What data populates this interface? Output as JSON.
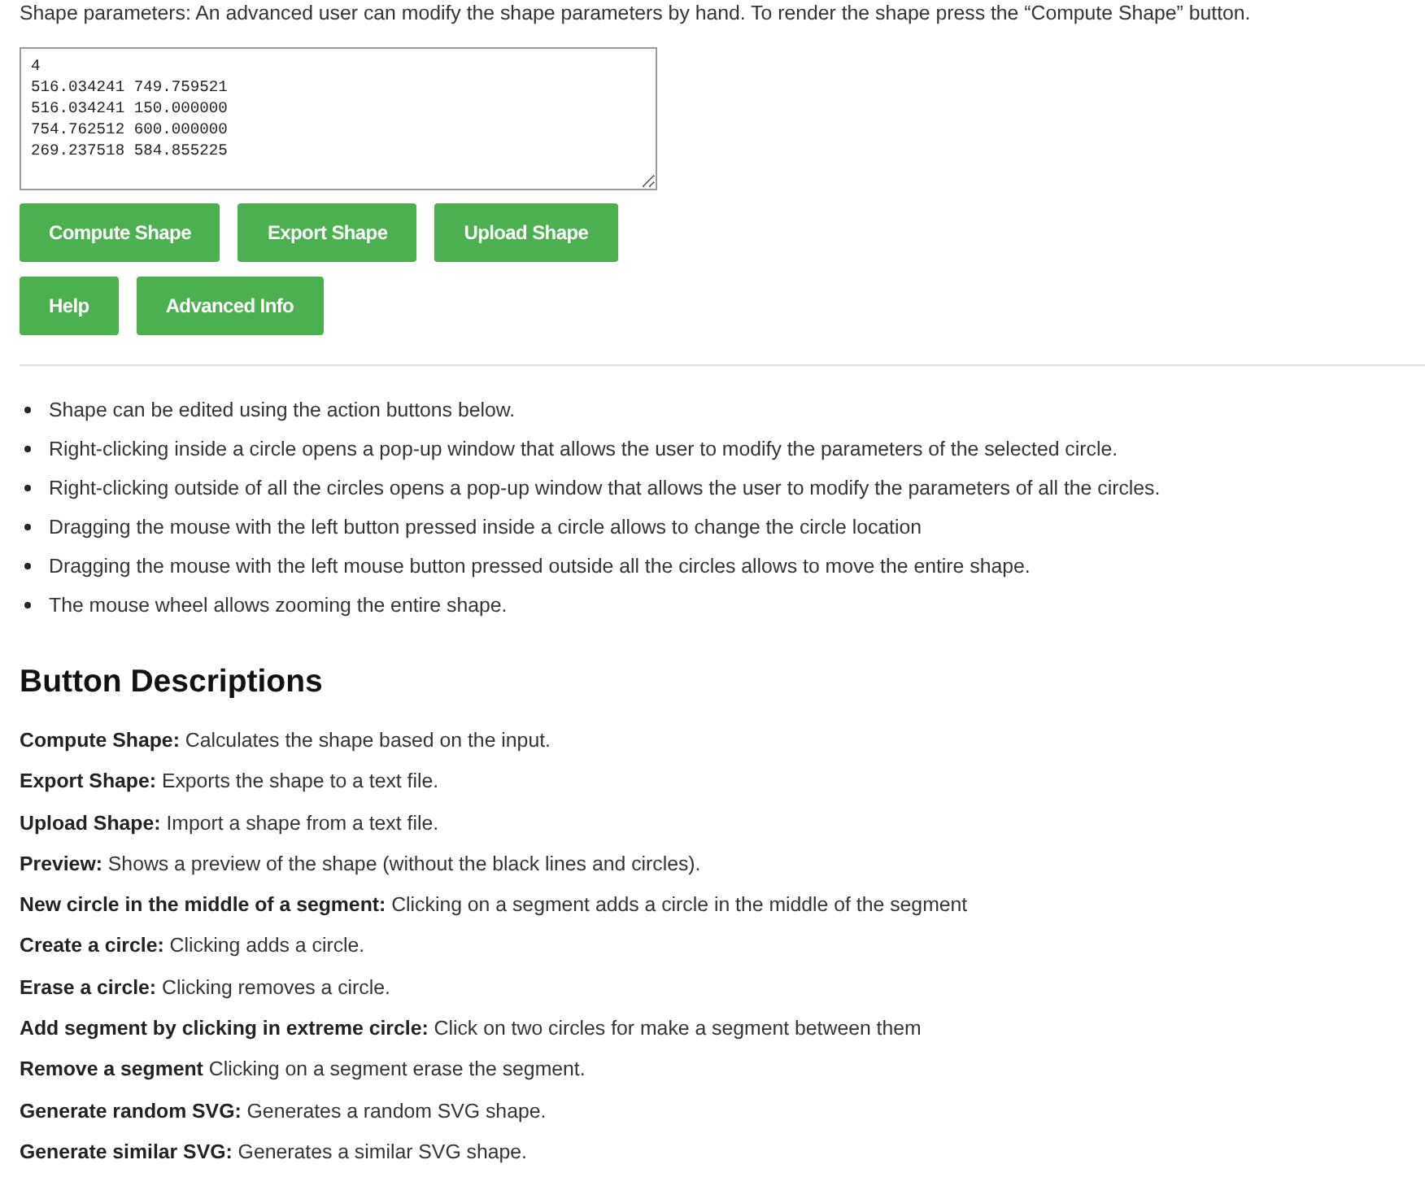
{
  "intro": "Shape parameters: An advanced user can modify the shape parameters by hand. To render the shape press the “Compute Shape” button.",
  "parameters_field": {
    "lines": [
      "4",
      "516.034241 749.759521",
      "516.034241 150.000000",
      "754.762512 600.000000",
      "269.237518 584.855225"
    ]
  },
  "button_rows": [
    [
      "Compute Shape",
      "Export Shape",
      "Upload Shape"
    ],
    [
      "Help",
      "Advanced Info"
    ]
  ],
  "bullets": [
    "Shape can be edited using the action buttons below.",
    "Right-clicking inside a circle opens a pop-up window that allows the user to modify the parameters of the selected circle.",
    "Right-clicking outside of all the circles opens a pop-up window that allows the user to modify the parameters of all the circles.",
    "Dragging the mouse with the left button pressed inside a circle allows to change the circle location",
    "Dragging the mouse with the left mouse button pressed outside all the circles allows to move the entire shape.",
    "The mouse wheel allows zooming the entire shape."
  ],
  "heading": "Button Descriptions",
  "descriptions": [
    "**Compute Shape:** Calculates the shape based on the input.",
    "**Export Shape:** Exports the shape to a text file.",
    "**Upload Shape:** Import a shape from a text file.",
    "**Preview:** Shows a preview of the shape (without the black lines and circles).",
    "**New circle in the middle of a segment:** Clicking on a segment adds a circle in the middle of the segment",
    "**Create a circle:** Clicking adds a circle.",
    "**Erase a circle:** Clicking removes a circle.",
    "**Add segment by clicking in extreme circle:** Click on two circles for make a segment between them",
    "**Remove a segment** Clicking on a segment erase the segment.",
    "**Generate random SVG:** Generates a random SVG shape.",
    "**Generate similar SVG:** Generates a similar SVG shape."
  ]
}
